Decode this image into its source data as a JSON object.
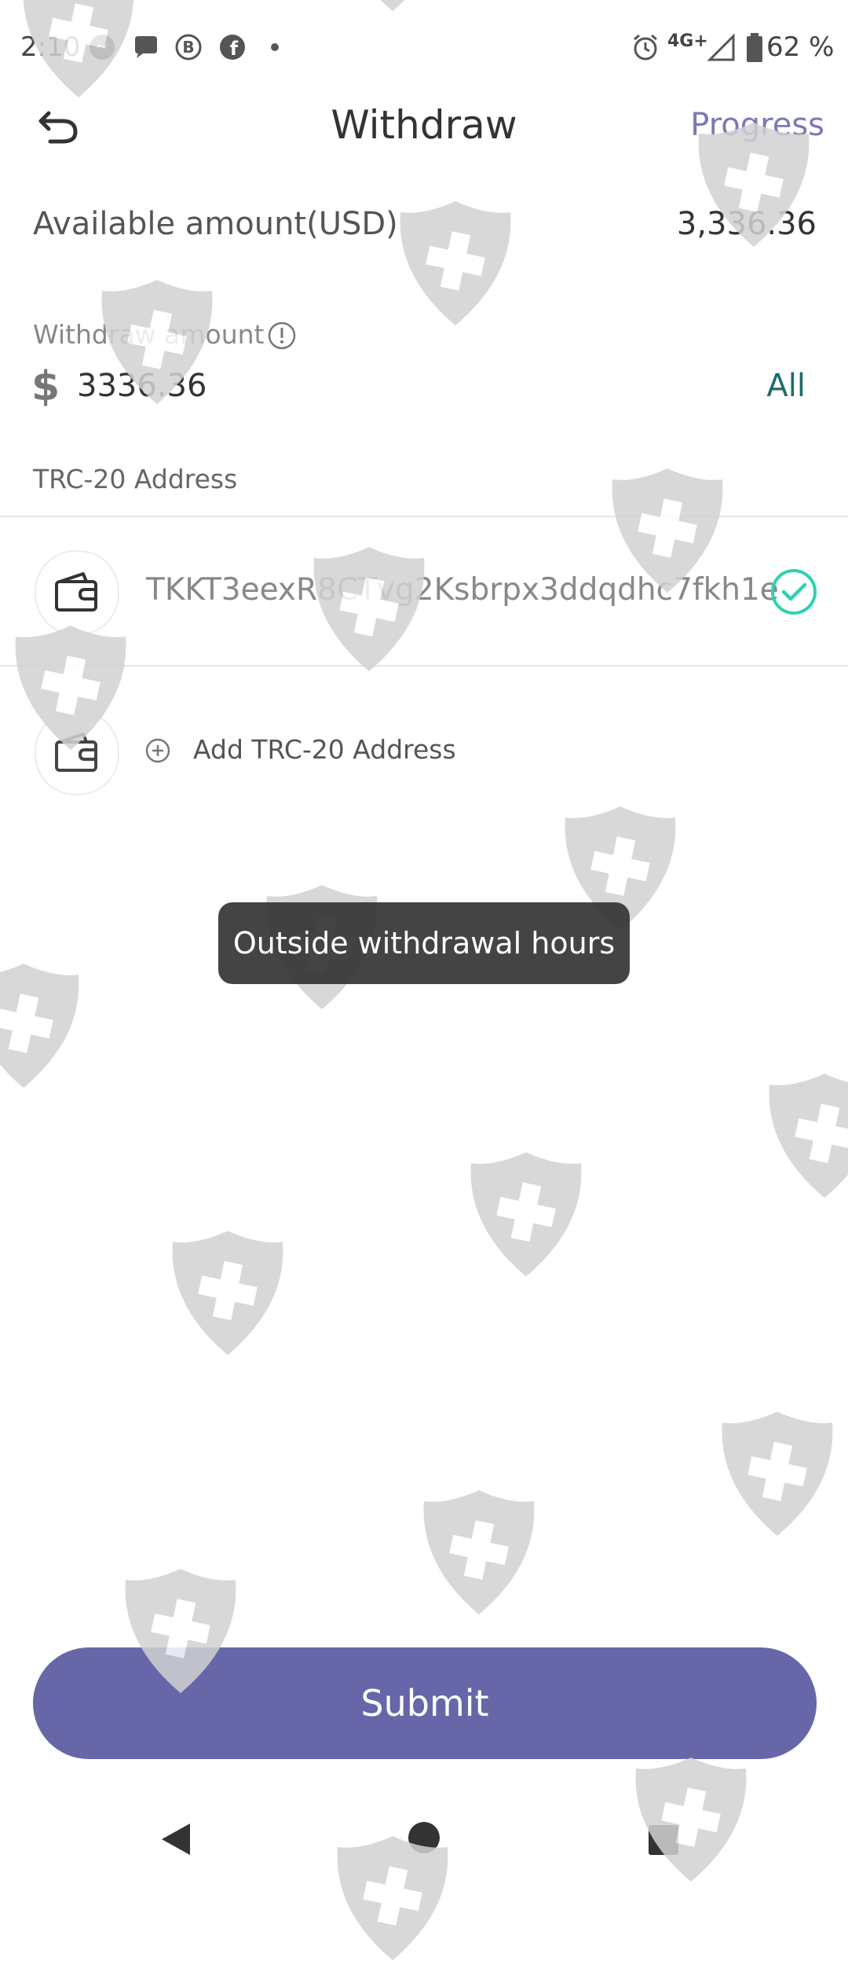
{
  "status_bar": {
    "time": "2:10",
    "network": "4G+",
    "battery": "62 %",
    "icons": [
      "messenger-icon",
      "chat-icon",
      "b-icon",
      "facebook-icon",
      "dot-icon",
      "alarm-icon",
      "signal-icon",
      "battery-icon"
    ]
  },
  "header": {
    "title": "Withdraw",
    "progress_label": "Progress"
  },
  "available": {
    "label": "Available amount(USD)",
    "value": "3,336.36"
  },
  "withdraw": {
    "label": "Withdraw amount",
    "currency_symbol": "$",
    "amount": "3336.36",
    "all_label": "All"
  },
  "address": {
    "section_label": "TRC-20 Address",
    "items": [
      {
        "address": "TKKT3eexR8CTvg2Ksbrpx3ddqdhc7fkh1e",
        "selected": true
      }
    ],
    "add_label": "Add TRC-20 Address"
  },
  "toast": {
    "message": "Outside withdrawal hours"
  },
  "submit_label": "Submit",
  "colors": {
    "accent": "#6666a8",
    "progress": "#7a78b6",
    "all": "#1c6b6b",
    "check": "#2fd1b4",
    "toast_bg": "#343434"
  }
}
